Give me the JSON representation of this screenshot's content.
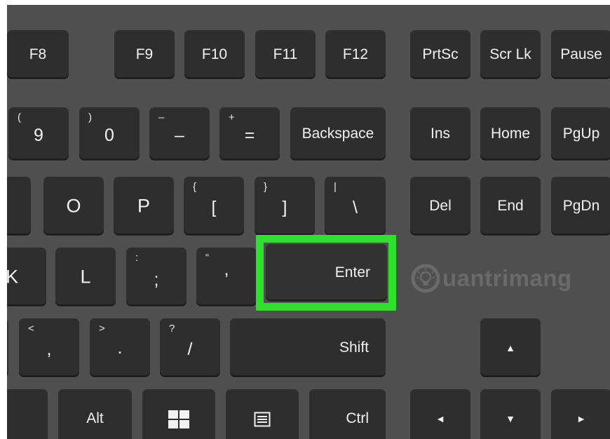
{
  "keys": {
    "f8": "F8",
    "f9": "F9",
    "f10": "F10",
    "f11": "F11",
    "f12": "F12",
    "prtsc": "PrtSc",
    "scrlk": "Scr Lk",
    "pause": "Pause",
    "nine_shift": "(",
    "nine": "9",
    "zero_shift": ")",
    "zero": "0",
    "minus_shift": "–",
    "minus": "–",
    "equals_shift": "+",
    "equals": "=",
    "backspace": "Backspace",
    "ins": "Ins",
    "home": "Home",
    "pgup": "PgUp",
    "o": "O",
    "p": "P",
    "lbracket_shift": "{",
    "lbracket": "[",
    "rbracket_shift": "}",
    "rbracket": "]",
    "backslash_shift": "|",
    "backslash": "\\",
    "del": "Del",
    "end": "End",
    "pgdn": "PgDn",
    "k": "K",
    "l": "L",
    "semicolon_shift": ":",
    "semicolon": ";",
    "quote_shift": "“",
    "quote": "’",
    "enter": "Enter",
    "comma_shift": "<",
    "comma": ",",
    "period_shift": ">",
    "period": ".",
    "slash_shift": "?",
    "slash": "/",
    "shift": "Shift",
    "up": "▲",
    "alt": "Alt",
    "ctrl": "Ctrl",
    "left": "◄",
    "down": "▼",
    "right": "►"
  },
  "watermark": "uantrimang",
  "colors": {
    "highlight": "#2fe02f",
    "keycap": "#2e2e2e",
    "board": "#4f4f4f"
  }
}
